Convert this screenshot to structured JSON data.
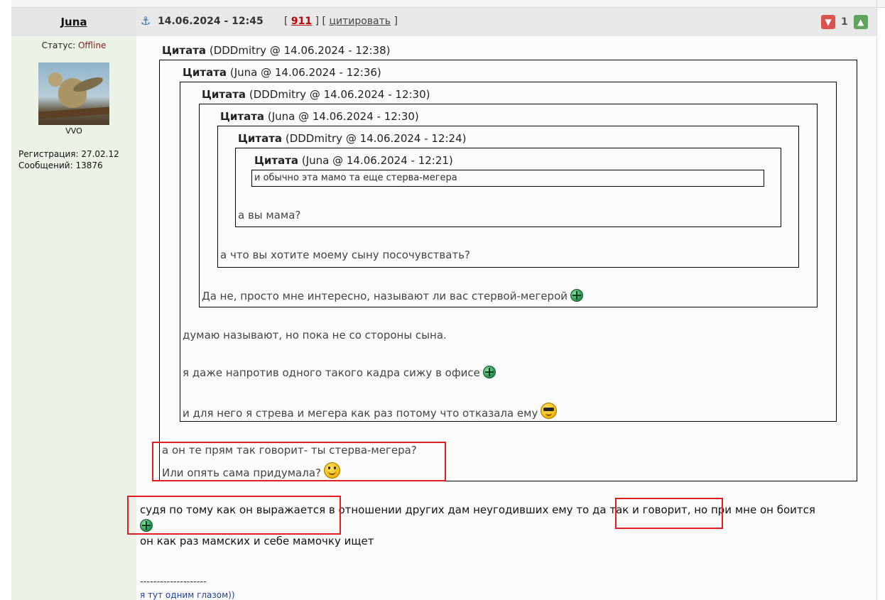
{
  "author": {
    "name": "Juna",
    "status_label": "Статус:",
    "status_value": "Offline",
    "avatar_caption": "VVO",
    "registration": "Регистрация: 27.02.12",
    "messages": "Сообщений: 13876"
  },
  "post": {
    "date": "14.06.2024 - 12:45",
    "number": "911",
    "cite_label": "цитировать",
    "rating": "1",
    "colors": {
      "red_highlight": "#e02020",
      "number": "#c00000",
      "offline": "#8b1a1a"
    }
  },
  "quotes": [
    {
      "label": "Цитата",
      "meta": "(DDDmitry @ 14.06.2024 - 12:38)",
      "reply": [
        "а он те прям так говорит- ты стерва-мегера?",
        "Или опять сама придумала?"
      ]
    },
    {
      "label": "Цитата",
      "meta": "(Juna @ 14.06.2024 - 12:36)",
      "reply": [
        "думаю называют, но пока не со стороны сына.",
        "я даже напротив одного такого кадра сижу в офисе",
        "и для него я стрева и мегера как раз потому что отказала ему"
      ]
    },
    {
      "label": "Цитата",
      "meta": "(DDDmitry @ 14.06.2024 - 12:30)",
      "reply": [
        "Да не, просто мне интересно, называют ли вас стервой-мегерой"
      ]
    },
    {
      "label": "Цитата",
      "meta": "(Juna @ 14.06.2024 - 12:30)",
      "reply": [
        "а что вы хотите моему сыну посочувствать?"
      ]
    },
    {
      "label": "Цитата",
      "meta": "(DDDmitry @ 14.06.2024 - 12:24)",
      "reply": [
        "а вы мама?"
      ]
    },
    {
      "label": "Цитата",
      "meta": "(Juna @ 14.06.2024 - 12:21)",
      "reply": [
        "и обычно эта мамо  та еще стерва-мегера"
      ]
    }
  ],
  "message": {
    "line1": "судя по тому как он выражается в отношении других дам неугодивших ему то да так и говорит, но при мне он боится",
    "line2": "он как раз мамских и себе мамочку ищет"
  },
  "signature": {
    "separator": "--------------------",
    "text": "я тут одним глазом))"
  }
}
